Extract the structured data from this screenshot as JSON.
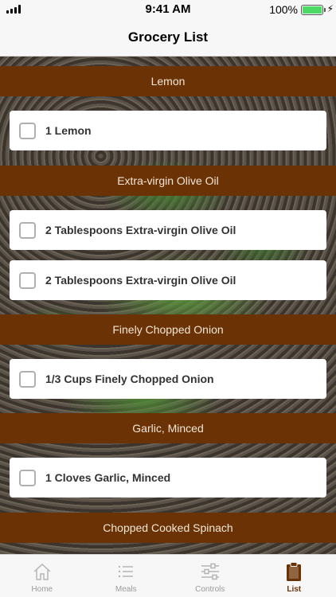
{
  "status_bar": {
    "time": "9:41 AM",
    "battery": "100%"
  },
  "nav": {
    "title": "Grocery List"
  },
  "sections": [
    {
      "header": "Lemon",
      "items": [
        "1 Lemon"
      ]
    },
    {
      "header": "Extra-virgin Olive Oil",
      "items": [
        "2 Tablespoons Extra-virgin Olive Oil",
        "2 Tablespoons Extra-virgin Olive Oil"
      ]
    },
    {
      "header": "Finely Chopped Onion",
      "items": [
        "1/3 Cups Finely Chopped Onion"
      ]
    },
    {
      "header": "Garlic, Minced",
      "items": [
        "1 Cloves Garlic, Minced"
      ]
    },
    {
      "header": "Chopped Cooked Spinach",
      "items": []
    }
  ],
  "tabs": [
    {
      "label": "Home",
      "icon": "home-icon"
    },
    {
      "label": "Meals",
      "icon": "list-icon"
    },
    {
      "label": "Controls",
      "icon": "sliders-icon"
    },
    {
      "label": "List",
      "icon": "clipboard-icon"
    }
  ],
  "active_tab": "List",
  "colors": {
    "section_header": "#6b3305",
    "active_tab": "#6b3305",
    "battery": "#4cd964"
  }
}
